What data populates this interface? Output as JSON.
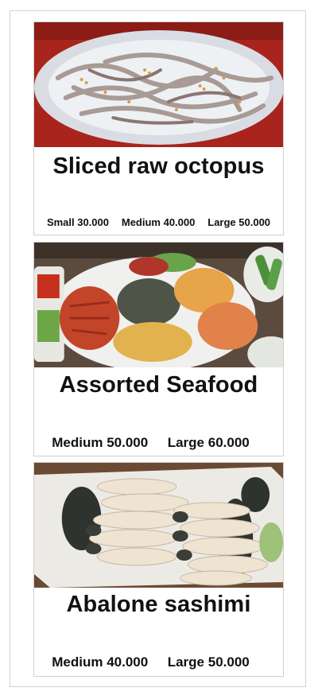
{
  "menu": [
    {
      "title": "Sliced raw octopus",
      "prices": [
        "Small 30.000",
        "Medium 40.000",
        "Large 50.000"
      ],
      "photo_icon": "sliced-octopus-photo"
    },
    {
      "title": "Assorted Seafood",
      "prices": [
        "Medium 50.000",
        "Large 60.000"
      ],
      "photo_icon": "assorted-seafood-photo"
    },
    {
      "title": "Abalone sashimi",
      "prices": [
        "Medium 40.000",
        "Large 50.000"
      ],
      "photo_icon": "abalone-sashimi-photo"
    }
  ]
}
